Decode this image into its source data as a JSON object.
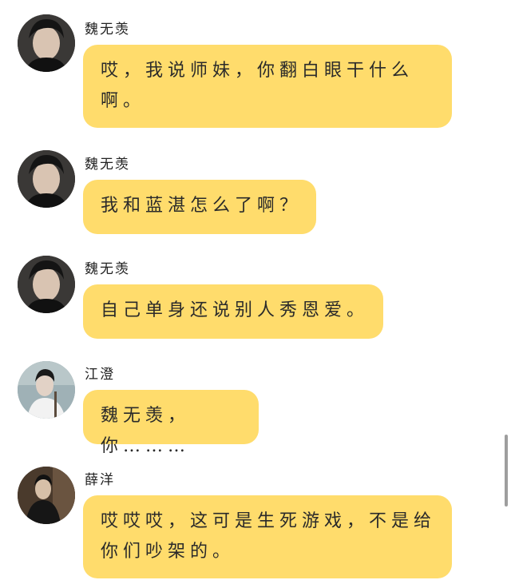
{
  "colors": {
    "bubble": "#ffdc6c",
    "background": "#ffffff"
  },
  "messages": [
    {
      "sender": "魏无羡",
      "avatar": "avatar-wei",
      "text": "哎，我说师妹，你翻白眼干什么啊。"
    },
    {
      "sender": "魏无羡",
      "avatar": "avatar-wei",
      "text": "我和蓝湛怎么了啊？"
    },
    {
      "sender": "魏无羡",
      "avatar": "avatar-wei",
      "text": "自己单身还说别人秀恩爱。"
    },
    {
      "sender": "江澄",
      "avatar": "avatar-jiang",
      "text": "魏无羡，你………"
    },
    {
      "sender": "薛洋",
      "avatar": "avatar-xue",
      "text": "哎哎哎，这可是生死游戏，不是给你们吵架的。"
    }
  ]
}
